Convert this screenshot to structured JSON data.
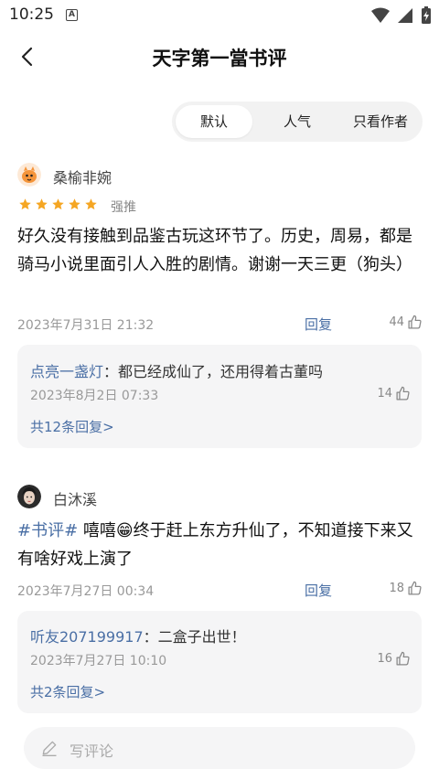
{
  "status_bar": {
    "time": "10:25",
    "notification_icon": "A"
  },
  "header": {
    "title": "天字第一當书评"
  },
  "tabs": [
    {
      "label": "默认",
      "active": true
    },
    {
      "label": "人气",
      "active": false
    },
    {
      "label": "只看作者",
      "active": false
    }
  ],
  "comments": [
    {
      "username": "桑榆非婉",
      "rating": 5,
      "rating_label": "强推",
      "tag": "",
      "text": "好久没有接触到品鉴古玩这环节了。历史，周易，都是骑马小说里面引人入胜的剧情。谢谢一天三更（狗头）",
      "date": "2023年7月31日 21:32",
      "reply_label": "回复",
      "likes": "44",
      "reply": {
        "author": "点亮一盏灯",
        "separator": "：",
        "text": "都已经成仙了，还用得着古董吗",
        "date": "2023年8月2日 07:33",
        "likes": "14",
        "more": "共12条回复>"
      }
    },
    {
      "username": "白沐溪",
      "tag": "#书评#",
      "text": " 嘻嘻😁终于赶上东方升仙了，不知道接下来又有啥好戏上演了",
      "date": "2023年7月27日 00:34",
      "reply_label": "回复",
      "likes": "18",
      "reply": {
        "author": "听友207199917",
        "separator": "：",
        "text": "二盒子出世！",
        "date": "2023年7月27日 10:10",
        "likes": "16",
        "more": "共2条回复>"
      }
    }
  ],
  "bottom": {
    "placeholder": "写评论"
  },
  "colors": {
    "accent": "#4a6fa5",
    "star": "#f5a623",
    "reply_bg": "#f5f5f6"
  }
}
